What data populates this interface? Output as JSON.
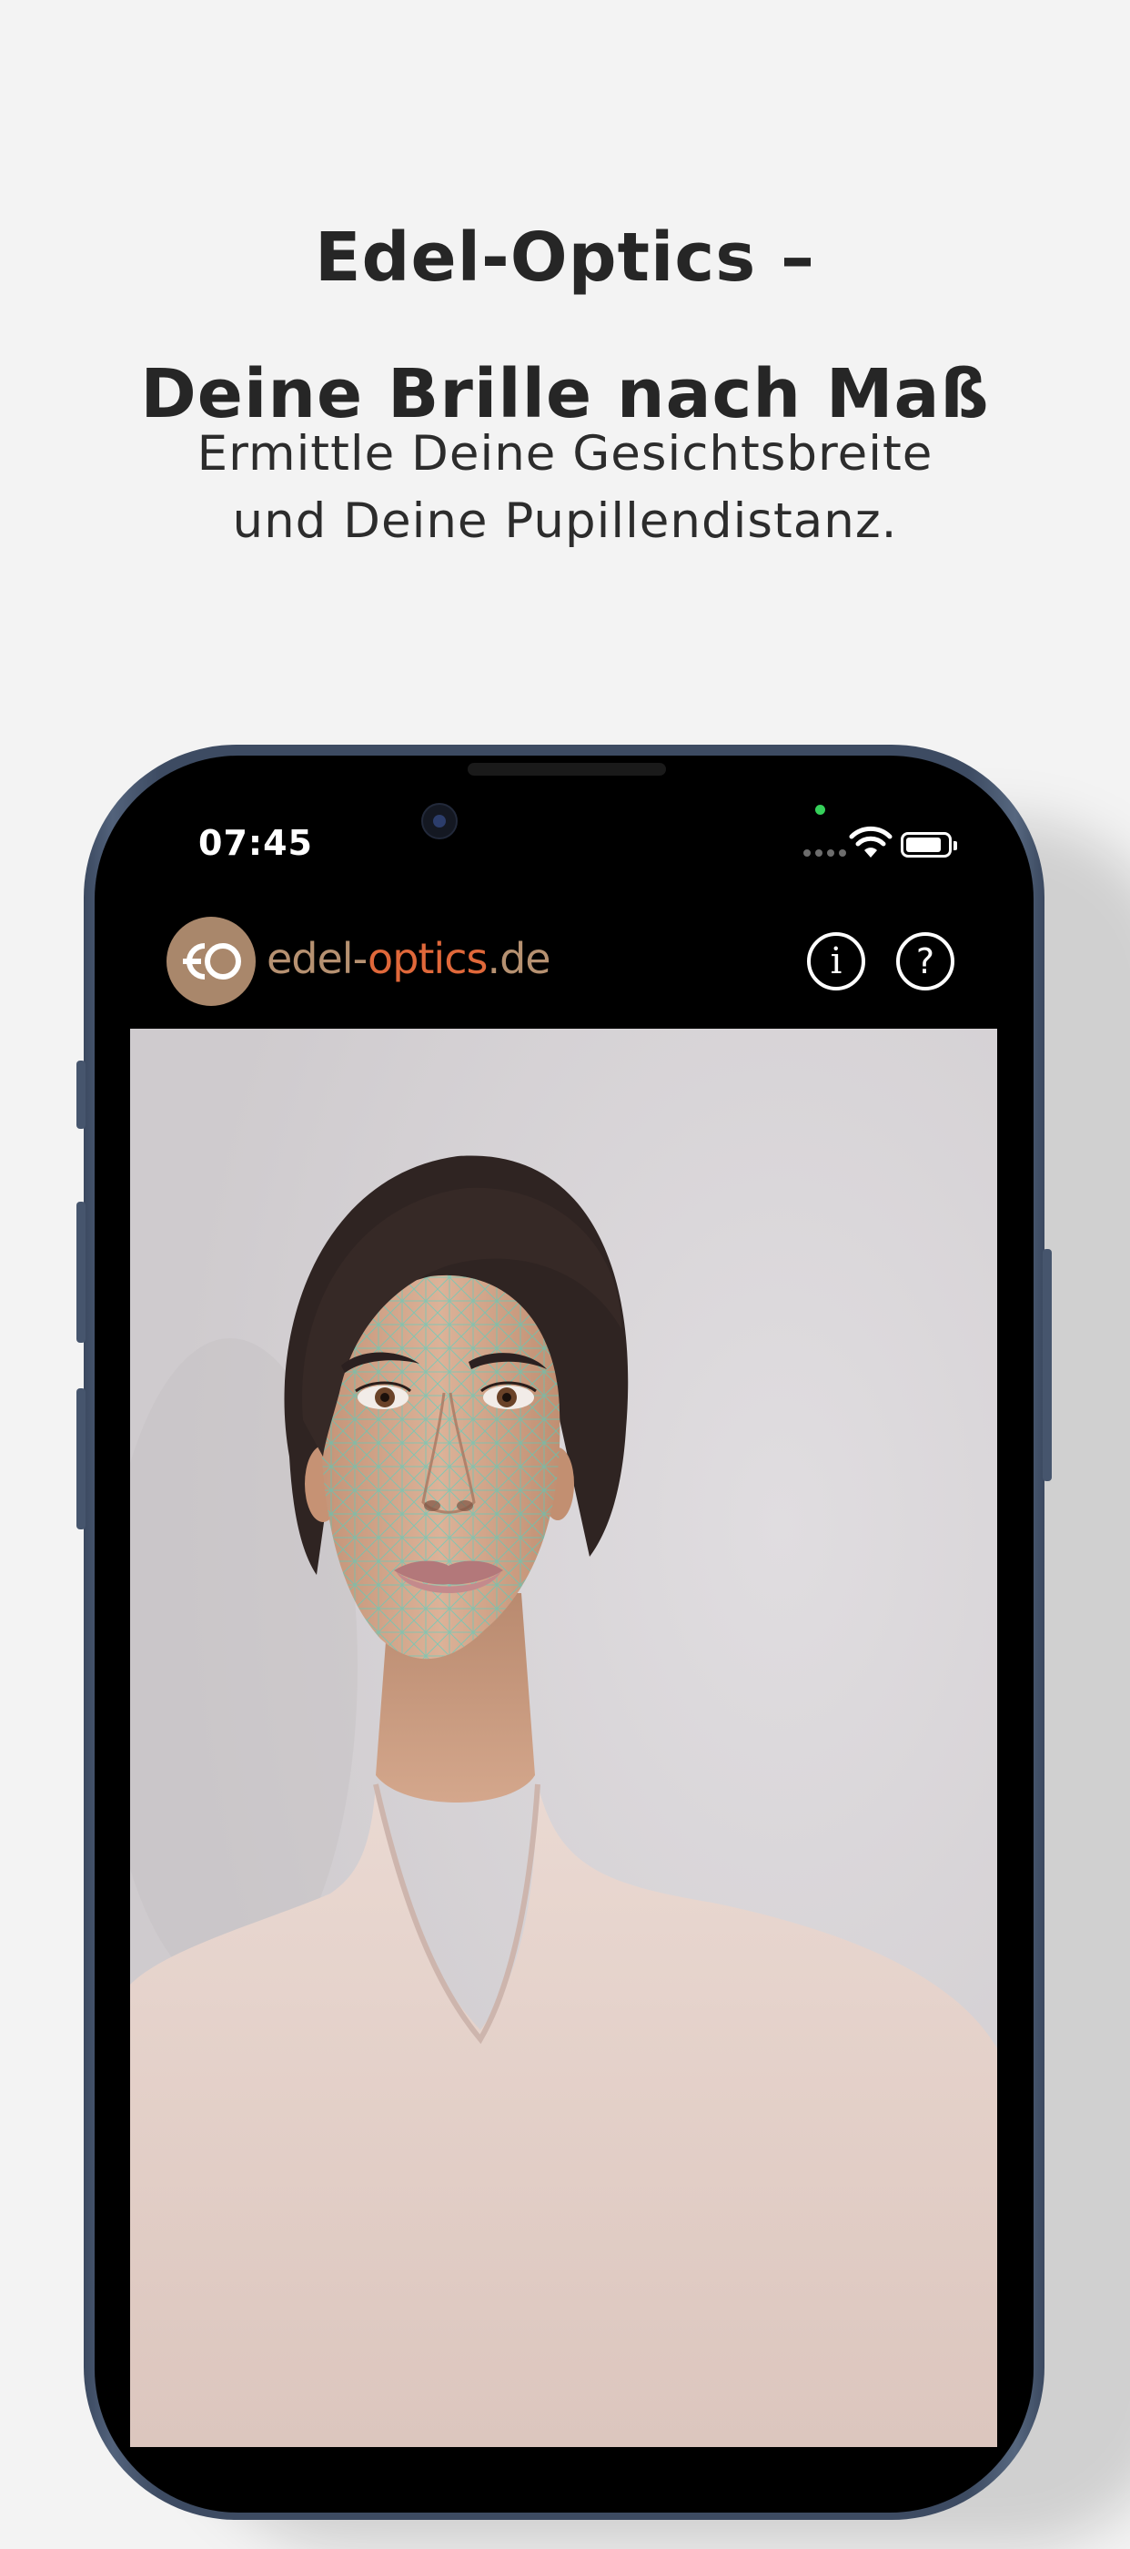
{
  "promo": {
    "headline_line1": "Edel-Optics –",
    "headline_line2": "Deine Brille nach Maß",
    "subline_line1": "Ermittle Deine Gesichtsbreite",
    "subline_line2": "und Deine Pupillendistanz."
  },
  "status_bar": {
    "time": "07:45"
  },
  "app_header": {
    "logo_text_part1": "edel-",
    "logo_text_part2": "optics",
    "logo_text_part3": ".de",
    "info_symbol": "i",
    "help_symbol": "?"
  },
  "colors": {
    "page_background": "#f3f3f3",
    "phone_frame": "#3d4b62",
    "logo_brown": "#a9876b",
    "logo_accent": "#e0683a",
    "face_mesh": "#3fd6c8"
  },
  "icons": {
    "info": "info-circle-icon",
    "help": "question-circle-icon",
    "wifi": "wifi-icon",
    "battery": "battery-icon",
    "signal": "signal-dots-icon"
  }
}
